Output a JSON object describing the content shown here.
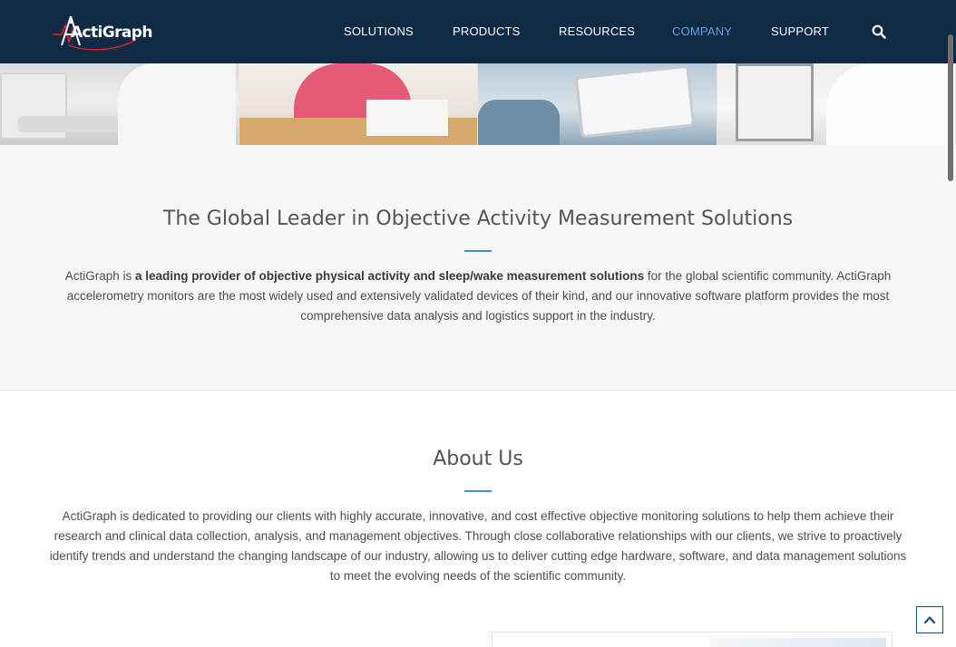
{
  "brand": {
    "logo_text": "ActiGraph"
  },
  "nav": {
    "items": [
      "SOLUTIONS",
      "PRODUCTS",
      "RESOURCES",
      "COMPANY",
      "SUPPORT"
    ],
    "active": "COMPANY",
    "search_icon": "search-icon"
  },
  "leader": {
    "title": "The Global Leader in Objective Activity Measurement Solutions",
    "lead_plain": "ActiGraph is ",
    "lead_bold": "a leading provider of objective physical activity and sleep/wake measurement solutions",
    "lead_rest": " for the global scientific community. ActiGraph accelerometry monitors are the most widely used and extensively validated devices of their kind, and our innovative software platform provides the most comprehensive data analysis and logistics support in the industry."
  },
  "about": {
    "title": "About Us",
    "text": "ActiGraph is dedicated to providing our clients with highly accurate, innovative, and cost effective objective monitoring solutions to help them achieve their research and clinical data collection, analysis, and management objectives. Through close collaborative relationships with our clients, we strive to proactively identify trends and understand the changing landscape of our industry, allowing us to deliver cutting edge hardware, software, and data management solutions to meet the evolving needs of the scientific community."
  },
  "ui": {
    "back_to_top_icon": "chevron-up-icon"
  },
  "colors": {
    "header_bg": "#0f2a44",
    "nav_active": "#5aa2e6",
    "accent_rule": "#4a8bc9"
  }
}
